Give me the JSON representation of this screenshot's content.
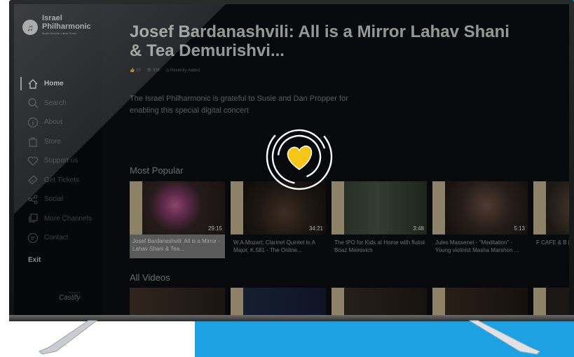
{
  "brand": {
    "name_line1": "Israel",
    "name_line2": "Philharmonic",
    "tagline": "Music Director Lahav Shani",
    "powered_by": "Powered by",
    "platform": "Castify"
  },
  "nav": {
    "items": [
      {
        "label": "Home",
        "icon": "home-icon",
        "active": true
      },
      {
        "label": "Search",
        "icon": "search-icon"
      },
      {
        "label": "About",
        "icon": "info-icon"
      },
      {
        "label": "Store",
        "icon": "bag-icon"
      },
      {
        "label": "Support us",
        "icon": "heart-icon"
      },
      {
        "label": "Get Tickets",
        "icon": "ticket-icon"
      },
      {
        "label": "Social",
        "icon": "share-icon"
      },
      {
        "label": "More Channels",
        "icon": "channels-icon"
      },
      {
        "label": "Contact",
        "icon": "chat-icon"
      }
    ],
    "exit_label": "Exit"
  },
  "hero": {
    "title": "Josef Bardanashvili: All is a Mirror Lahav Shani & Tea Demurishvi...",
    "likes": "10",
    "views": "935",
    "status": "Recently Added",
    "description": "The Israel Philharmonic is grateful to Susie and Dan Propper for enabling this special digital concert"
  },
  "most_popular": {
    "title": "Most Popular",
    "cards": [
      {
        "title": "Josef Bardanashvili: All is a Mirror - Lahav Shani & Tea...",
        "duration": "29:15"
      },
      {
        "title": "W.A.Mozart: Clarinet Quintet in A Major, K.581 - The Online...",
        "duration": "34:21"
      },
      {
        "title": "The IPO for Kids at Home with flutist Boaz Meirovich",
        "duration": "3:48"
      },
      {
        "title": "Jules Massenet - \"Meditation\" - Young violinist Masha Marshon ...",
        "duration": "5:13"
      },
      {
        "title": "F CAFE & B | FTV",
        "duration": ""
      }
    ]
  },
  "all_videos": {
    "title": "All Videos"
  },
  "colors": {
    "backdrop_blue": "#1da1e2",
    "loader_heart": "#f5c518",
    "active_card": "#8a8a8a"
  }
}
